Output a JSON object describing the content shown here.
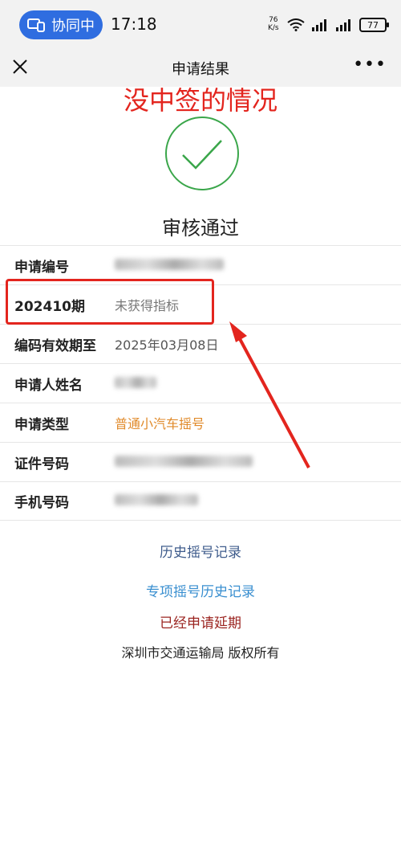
{
  "status_bar": {
    "collab_label": "协同中",
    "time": "17:18",
    "net_speed_value": "76",
    "net_speed_unit": "K/s",
    "battery": "77"
  },
  "nav": {
    "title": "申请结果",
    "more": "•••"
  },
  "annotation": "没中签的情况",
  "result": {
    "title": "审核通过",
    "accent_color": "#3aa64a"
  },
  "rows": [
    {
      "label": "申请编号",
      "value": ""
    },
    {
      "label": "202410期",
      "value": "未获得指标"
    },
    {
      "label": "编码有效期至",
      "value": "2025年03月08日"
    },
    {
      "label": "申请人姓名",
      "value": ""
    },
    {
      "label": "申请类型",
      "value": "普通小汽车摇号"
    },
    {
      "label": "证件号码",
      "value": ""
    },
    {
      "label": "手机号码",
      "value": ""
    }
  ],
  "links": {
    "history": "历史摇号记录",
    "special_history": "专项摇号历史记录",
    "extended": "已经申请延期"
  },
  "footer": "深圳市交通运输局 版权所有"
}
